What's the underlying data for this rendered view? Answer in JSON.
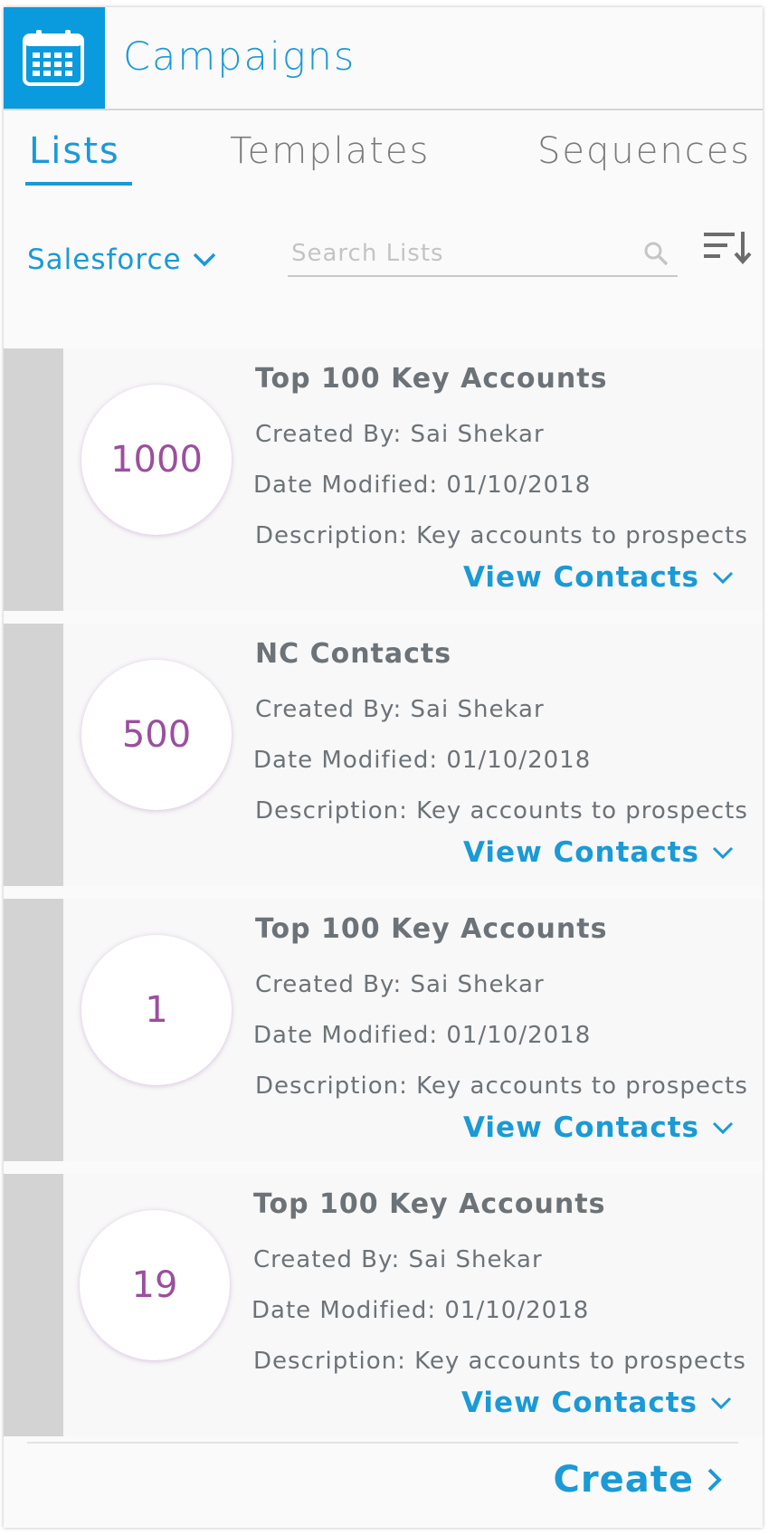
{
  "header": {
    "icon": "calendar-icon",
    "title": "Campaigns"
  },
  "tabs": [
    {
      "label": "Lists",
      "active": true
    },
    {
      "label": "Templates",
      "active": false
    },
    {
      "label": "Sequences",
      "active": false
    }
  ],
  "filter": {
    "source": "Salesforce",
    "search_placeholder": "Search Lists",
    "sort_icon": "sort-descending-icon"
  },
  "labels": {
    "created_by": "Created By:",
    "date_modified": "Date Modified:",
    "description": "Description:",
    "view_contacts": "View Contacts"
  },
  "lists": [
    {
      "count": "1000",
      "title": "Top 100 Key Accounts",
      "created_by": "Sai Shekar",
      "date_modified": "01/10/2018",
      "description": "Key accounts to prospects"
    },
    {
      "count": "500",
      "title": "NC Contacts",
      "created_by": "Sai Shekar",
      "date_modified": "01/10/2018",
      "description": "Key accounts to prospects"
    },
    {
      "count": "1",
      "title": "Top 100 Key Accounts",
      "created_by": "Sai Shekar",
      "date_modified": "01/10/2018",
      "description": "Key accounts to prospects"
    },
    {
      "count": "19",
      "title": "Top 100 Key Accounts",
      "created_by": "Sai Shekar",
      "date_modified": "01/10/2018",
      "description": "Key accounts to prospects"
    }
  ],
  "footer": {
    "create_label": "Create"
  },
  "colors": {
    "accent": "#1a9ad6",
    "count_text": "#9b4f9e",
    "card_bar": "#d3d3d3"
  }
}
